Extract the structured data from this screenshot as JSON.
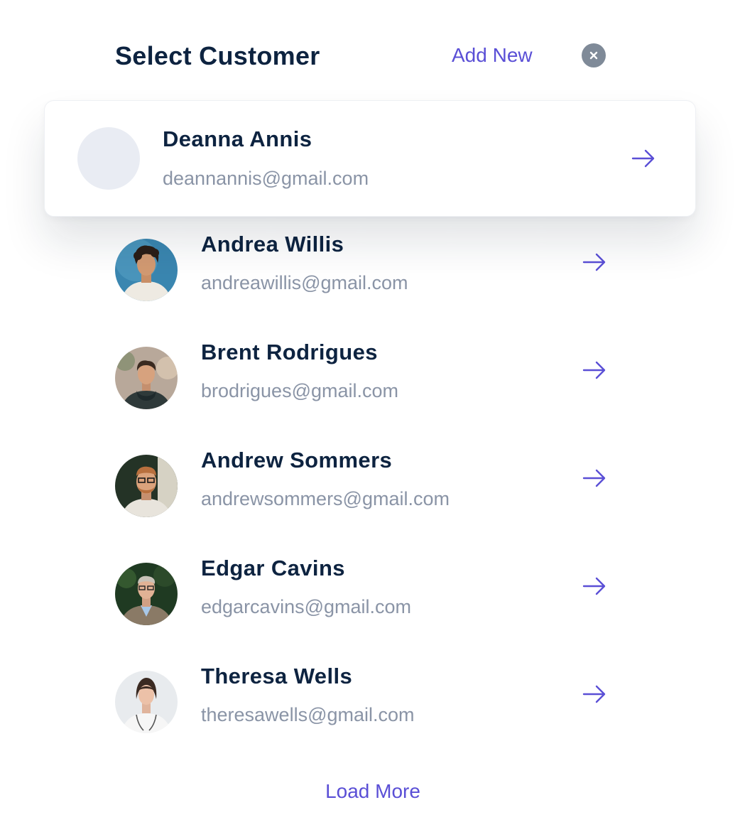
{
  "header": {
    "title": "Select Customer",
    "add_new_label": "Add New",
    "close_icon": "close-icon"
  },
  "selected": {
    "name": "Deanna Annis",
    "email": "deannannis@gmail.com",
    "icon": "arrow-right-icon"
  },
  "customers": [
    {
      "name": "Andrea Willis",
      "email": "andreawillis@gmail.com"
    },
    {
      "name": "Brent Rodrigues",
      "email": "brodrigues@gmail.com"
    },
    {
      "name": "Andrew Sommers",
      "email": "andrewsommers@gmail.com"
    },
    {
      "name": "Edgar Cavins",
      "email": "edgarcavins@gmail.com"
    },
    {
      "name": "Theresa Wells",
      "email": "theresawells@gmail.com"
    }
  ],
  "footer": {
    "load_more_label": "Load More"
  },
  "colors": {
    "accent": "#5a4fd6",
    "heading": "#0d2340",
    "muted": "#8a94a6",
    "close_bg": "#7f8a98"
  }
}
